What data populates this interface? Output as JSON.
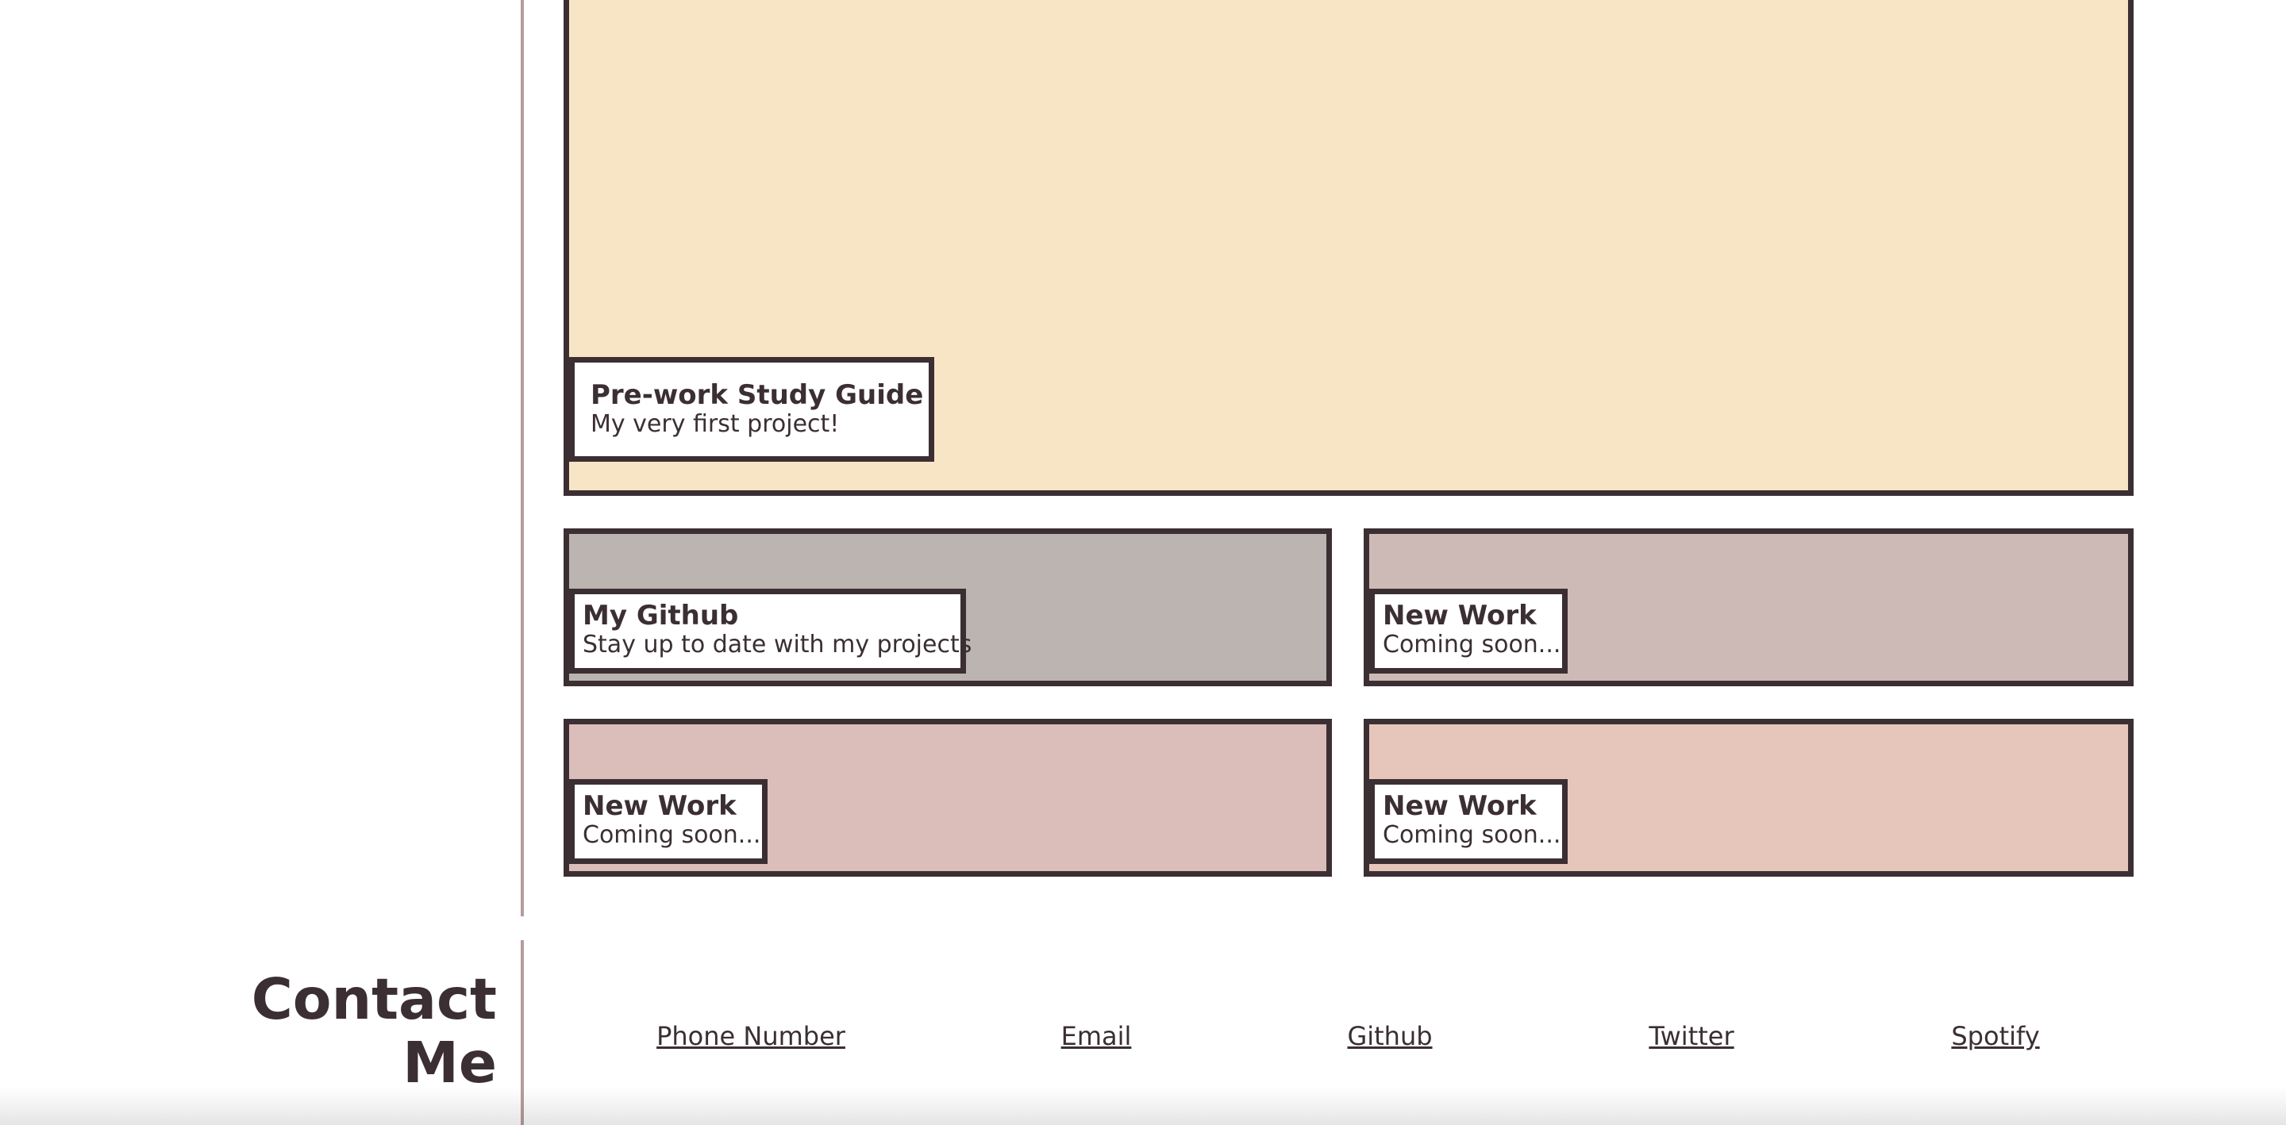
{
  "projects": {
    "featured": {
      "title": "Pre-work Study Guide",
      "subtitle": "My very first project!",
      "color": "#f8e5c6"
    },
    "github": {
      "title": "My Github",
      "subtitle": "Stay up to date with my projects",
      "color": "#bbb4b1"
    },
    "new_work_1": {
      "title": "New Work",
      "subtitle": "Coming soon...",
      "color": "#cdbab7"
    },
    "new_work_2": {
      "title": "New Work",
      "subtitle": "Coming soon...",
      "color": "#dbbdb9"
    },
    "new_work_3": {
      "title": "New Work",
      "subtitle": "Coming soon..."
    }
  },
  "contact": {
    "heading": "Contact Me",
    "links": {
      "phone": "Phone Number",
      "email": "Email",
      "github": "Github",
      "twitter": "Twitter",
      "spotify": "Spotify"
    }
  },
  "colors": {
    "text": "#3b2f33",
    "border": "#3b2f33",
    "divider": "#b79c9c",
    "card_peach": "#e6c6bb"
  }
}
